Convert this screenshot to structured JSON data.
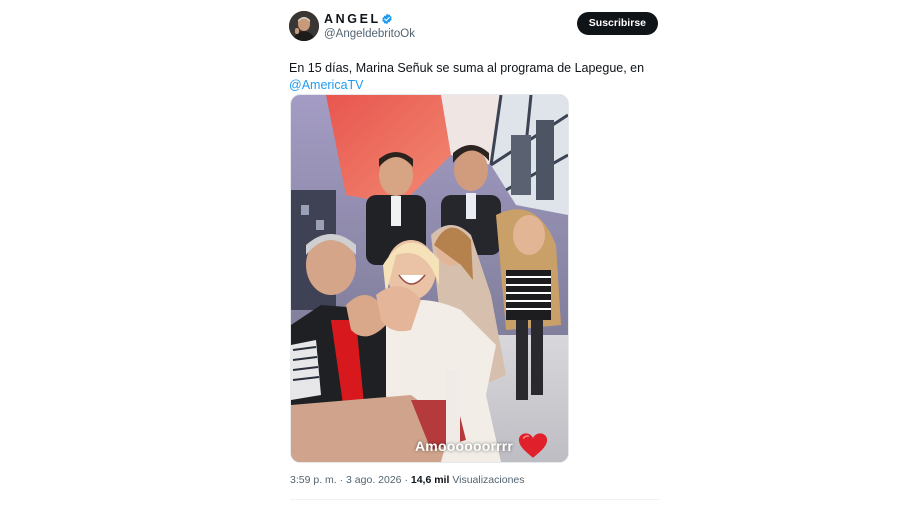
{
  "author": {
    "display_name": "ANGEL",
    "handle": "@AngeldebritoOk",
    "verified": true
  },
  "subscribe_label": "Suscribirse",
  "tweet": {
    "text": "En 15 días, Marina Señuk se suma al programa de Lapegue, en",
    "mention": "@AmericaTV"
  },
  "media": {
    "caption": "Amoooooorrrr",
    "caption_emoji": "heart-emoji"
  },
  "meta": {
    "time": "3:59 p. m.",
    "separator": "·",
    "date": "3 ago. 2026",
    "views_count": "14,6 mil",
    "views_label": "Visualizaciones"
  },
  "colors": {
    "accent": "#1d9bf0",
    "button_bg": "#0f1419",
    "text_primary": "#0f1419",
    "text_secondary": "#536471"
  }
}
